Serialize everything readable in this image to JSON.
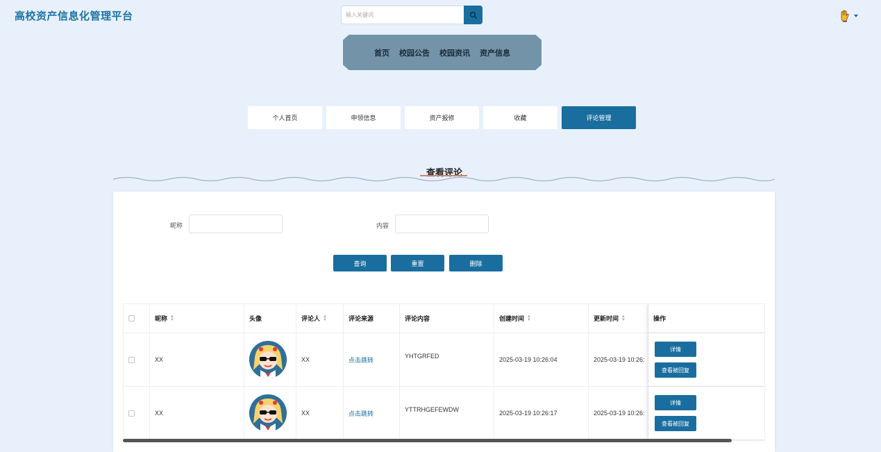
{
  "header": {
    "brand": "高校资产信息化管理平台",
    "search_placeholder": "输入关键词"
  },
  "nav": {
    "items": [
      {
        "label": "首页"
      },
      {
        "label": "校园公告"
      },
      {
        "label": "校园资讯"
      },
      {
        "label": "资产信息"
      }
    ]
  },
  "tabs": [
    {
      "label": "个人首页",
      "active": false
    },
    {
      "label": "申领信息",
      "active": false
    },
    {
      "label": "资产报修",
      "active": false
    },
    {
      "label": "收藏",
      "active": false
    },
    {
      "label": "评论管理",
      "active": true
    }
  ],
  "section": {
    "title": "查看评论"
  },
  "filters": {
    "nickname_label": "昵称",
    "nickname_value": "",
    "content_label": "内容",
    "content_value": ""
  },
  "actions": {
    "query": "查询",
    "reset": "重置",
    "delete": "删除"
  },
  "table": {
    "columns": {
      "nickname": "昵称",
      "avatar": "头像",
      "commenter": "评论人",
      "source": "评论来源",
      "content": "评论内容",
      "created": "创建时间",
      "updated": "更新时间",
      "ops": "操作"
    },
    "rows": [
      {
        "nickname": "XX",
        "commenter": "XX",
        "source": "点击跳转",
        "content": "YHTGRFED",
        "created": "2025-03-19 10:26:04",
        "updated": "2025-03-19 10:26:",
        "detail": "详情",
        "view_reply": "查看被回复"
      },
      {
        "nickname": "XX",
        "commenter": "XX",
        "source": "点击跳转",
        "content": "YTTRHGEFEWDW",
        "created": "2025-03-19 10:26:17",
        "updated": "2025-03-19 10:26:",
        "detail": "详情",
        "view_reply": "查看被回复"
      }
    ]
  },
  "colors": {
    "primary": "#1a6e9f",
    "background": "#e8f1fb",
    "nav_bg": "#7393a9",
    "brand": "#1e73a8"
  },
  "icons": {
    "search": "search-icon",
    "user": "hand-wave-icon",
    "caret": "caret-down-icon",
    "sort": "sort-icon"
  }
}
